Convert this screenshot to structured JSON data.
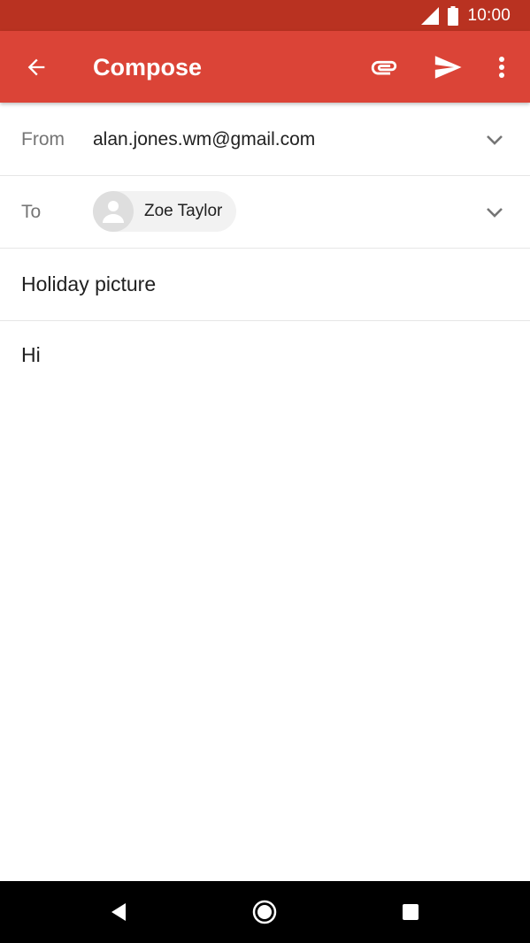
{
  "status_bar": {
    "time": "10:00",
    "icons": [
      "signal-icon",
      "battery-icon"
    ]
  },
  "app_bar": {
    "title": "Compose",
    "icons": [
      "back-arrow-icon",
      "paperclip-icon",
      "send-icon",
      "more-vert-icon"
    ],
    "color": "#db4437"
  },
  "from": {
    "label": "From",
    "value": "alan.jones.wm@gmail.com"
  },
  "to": {
    "label": "To",
    "recipients": [
      {
        "name": "Zoe Taylor"
      }
    ]
  },
  "subject": {
    "value": "Holiday picture",
    "placeholder": ""
  },
  "body": {
    "value": "Hi"
  },
  "nav_bar": {
    "icons": [
      "nav-back-icon",
      "nav-home-icon",
      "nav-recents-icon"
    ]
  },
  "colors": {
    "status_bar": "#b93221",
    "app_bar": "#db4437",
    "text": "#212121",
    "label": "#757575"
  }
}
